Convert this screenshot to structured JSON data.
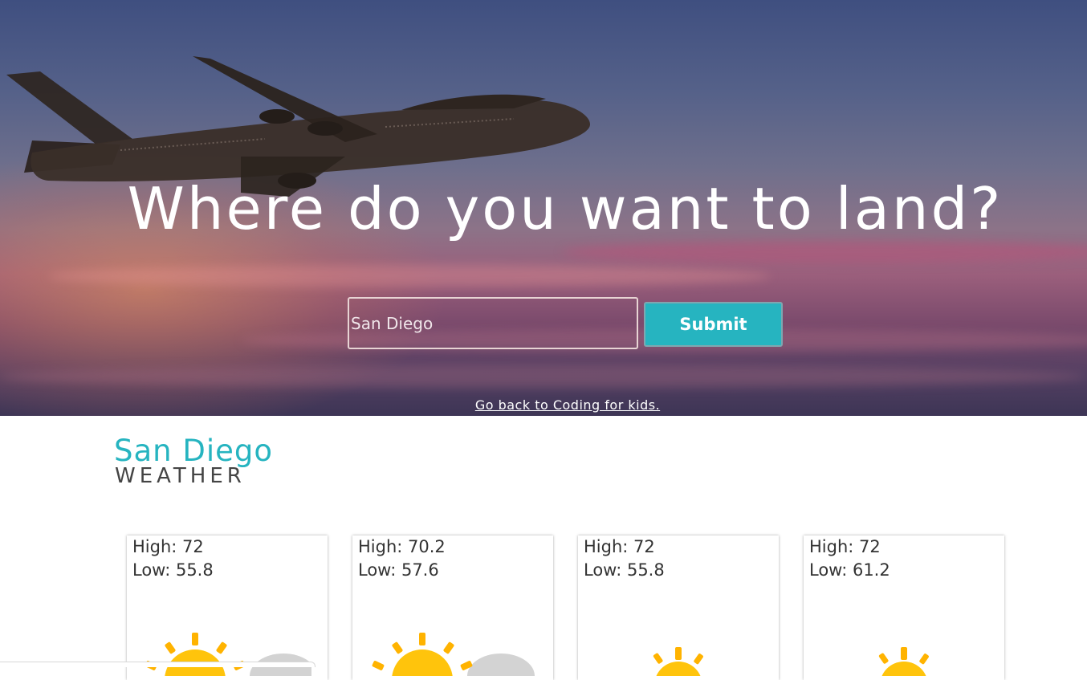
{
  "hero": {
    "title": "Where do you want to land?",
    "search_value": "San Diego",
    "submit_label": "Submit",
    "back_link": "Go back to Coding for kids."
  },
  "weather": {
    "city": "San Diego",
    "label": "WEATHER",
    "accent_color": "#26b4c0",
    "days": [
      {
        "high": "High: 72",
        "low": "Low: 55.8",
        "icon": "partly-cloudy-icon"
      },
      {
        "high": "High: 70.2",
        "low": "Low: 57.6",
        "icon": "partly-cloudy-icon"
      },
      {
        "high": "High: 72",
        "low": "Low: 55.8",
        "icon": "sun-icon"
      },
      {
        "high": "High: 72",
        "low": "Low: 61.2",
        "icon": "sun-icon"
      }
    ]
  }
}
